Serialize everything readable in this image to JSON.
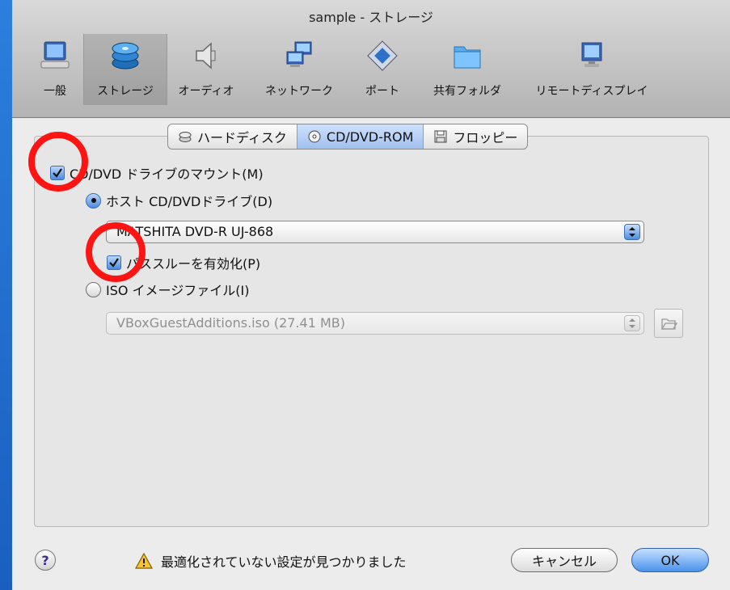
{
  "window": {
    "title": "sample - ストレージ"
  },
  "toolbar": {
    "items": [
      {
        "label": "一般",
        "icon": "computer-icon"
      },
      {
        "label": "ストレージ",
        "icon": "storage-icon",
        "selected": true
      },
      {
        "label": "オーディオ",
        "icon": "speaker-icon"
      },
      {
        "label": "ネットワーク",
        "icon": "network-icon"
      },
      {
        "label": "ポート",
        "icon": "port-icon"
      },
      {
        "label": "共有フォルダ",
        "icon": "folder-icon"
      },
      {
        "label": "リモートディスプレイ",
        "icon": "monitor-icon"
      }
    ]
  },
  "tabs": [
    {
      "label": "ハードディスク",
      "icon": "harddisk-icon"
    },
    {
      "label": "CD/DVD-ROM",
      "icon": "cd-icon",
      "active": true
    },
    {
      "label": "フロッピー",
      "icon": "floppy-icon"
    }
  ],
  "cdrom": {
    "mount_label": "CD/DVD ドライブのマウント(M)",
    "mount_checked": true,
    "host_drive_label": "ホスト CD/DVDドライブ(D)",
    "host_drive_selected": true,
    "host_drive_value": "MATSHITA DVD-R   UJ-868",
    "passthrough_label": "パススルーを有効化(P)",
    "passthrough_checked": true,
    "iso_label": "ISO イメージファイル(I)",
    "iso_selected": false,
    "iso_value": "VBoxGuestAdditions.iso (27.41 MB)"
  },
  "footer": {
    "help_label": "?",
    "warning_text": "最適化されていない設定が見つかりました",
    "cancel_label": "キャンセル",
    "ok_label": "OK"
  },
  "colors": {
    "accent": "#4a8be1",
    "annotation": "#ff1414",
    "desktop": "#1b6fd0"
  }
}
